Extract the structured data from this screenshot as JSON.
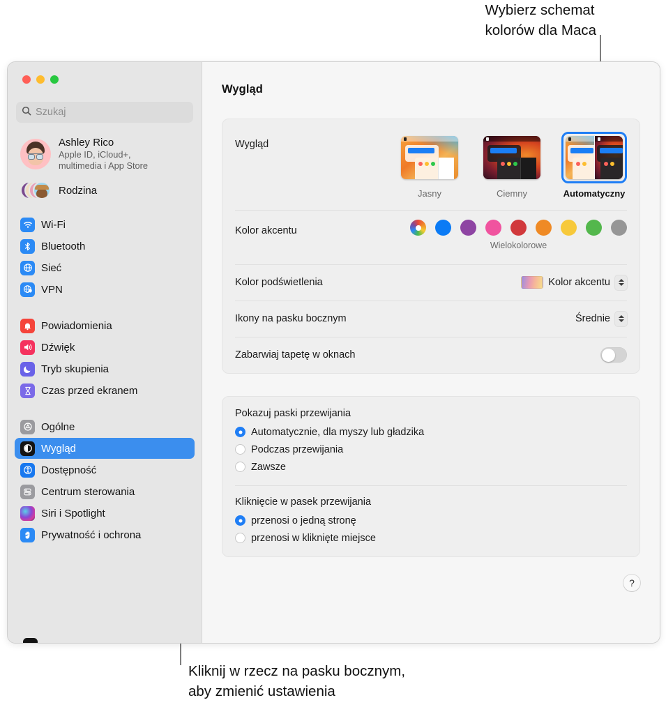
{
  "callouts": {
    "top": "Wybierz schemat\nkolorów dla Maca",
    "bottom": "Kliknij w rzecz na pasku bocznym,\naby zmienić ustawienia"
  },
  "window": {
    "traffic_lights": [
      "close-red",
      "minimize-yellow",
      "zoom-green"
    ]
  },
  "sidebar": {
    "search": {
      "placeholder": "Szukaj",
      "value": "",
      "icon": "search-icon"
    },
    "account": {
      "name": "Ashley Rico",
      "subtitle": "Apple ID, iCloud+,\nmultimedia i App Store",
      "subtitle_line1": "Apple ID, iCloud+,",
      "subtitle_line2": "multimedia i App Store"
    },
    "family": {
      "label": "Rodzina"
    },
    "groups": [
      {
        "items": [
          {
            "label": "Wi-Fi",
            "icon": "wifi-icon"
          },
          {
            "label": "Bluetooth",
            "icon": "bluetooth-icon"
          },
          {
            "label": "Sieć",
            "icon": "network-globe-icon"
          },
          {
            "label": "VPN",
            "icon": "vpn-shield-globe-icon"
          }
        ]
      },
      {
        "items": [
          {
            "label": "Powiadomienia",
            "icon": "notifications-bell-icon"
          },
          {
            "label": "Dźwięk",
            "icon": "sound-speaker-icon"
          },
          {
            "label": "Tryb skupienia",
            "icon": "focus-moon-icon"
          },
          {
            "label": "Czas przed ekranem",
            "icon": "screen-time-hourglass-icon"
          }
        ]
      },
      {
        "items": [
          {
            "label": "Ogólne",
            "icon": "general-gear-icon"
          },
          {
            "label": "Wygląd",
            "icon": "appearance-contrast-icon",
            "selected": true
          },
          {
            "label": "Dostępność",
            "icon": "accessibility-person-icon"
          },
          {
            "label": "Centrum sterowania",
            "icon": "control-center-sliders-icon"
          },
          {
            "label": "Siri i Spotlight",
            "icon": "siri-orb-icon"
          },
          {
            "label": "Prywatność i ochrona",
            "icon": "privacy-hand-icon"
          }
        ]
      }
    ]
  },
  "content": {
    "title": "Wygląd",
    "appearance": {
      "label": "Wygląd",
      "options": [
        {
          "label": "Jasny",
          "value": "light",
          "selected": false
        },
        {
          "label": "Ciemny",
          "value": "dark",
          "selected": false
        },
        {
          "label": "Automatyczny",
          "value": "auto",
          "selected": true
        }
      ]
    },
    "accent": {
      "label": "Kolor akcentu",
      "caption": "Wielokolorowe",
      "selected_index": 0,
      "swatches": [
        {
          "name": "multicolor",
          "color": "multicolor"
        },
        {
          "name": "blue",
          "color": "#0b7bf5"
        },
        {
          "name": "purple",
          "color": "#8e44a3"
        },
        {
          "name": "pink",
          "color": "#f0539f"
        },
        {
          "name": "red",
          "color": "#d1393c"
        },
        {
          "name": "orange",
          "color": "#ef8a25"
        },
        {
          "name": "yellow",
          "color": "#f7c93b"
        },
        {
          "name": "green",
          "color": "#53b74c"
        },
        {
          "name": "graphite",
          "color": "#969696"
        }
      ]
    },
    "highlight": {
      "label": "Kolor podświetlenia",
      "value": "Kolor akcentu"
    },
    "sidebar_icons": {
      "label": "Ikony na pasku bocznym",
      "value": "Średnie"
    },
    "wallpaper_tint": {
      "label": "Zabarwiaj tapetę w oknach",
      "enabled": false
    },
    "show_scrollbars": {
      "title": "Pokazuj paski przewijania",
      "options": [
        {
          "label": "Automatycznie, dla myszy lub gładzika",
          "selected": true
        },
        {
          "label": "Podczas przewijania",
          "selected": false
        },
        {
          "label": "Zawsze",
          "selected": false
        }
      ]
    },
    "click_scrollbar": {
      "title": "Kliknięcie w pasek przewijania",
      "options": [
        {
          "label": "przenosi o jedną stronę",
          "selected": true
        },
        {
          "label": "przenosi w kliknięte miejsce",
          "selected": false
        }
      ]
    },
    "help": {
      "label": "?"
    }
  },
  "colors": {
    "accent": "#3b8eee",
    "selection": "#1f7ef5",
    "sidebar_bg": "#e6e6e6",
    "content_bg": "#f6f6f6",
    "card_bg": "#efefef"
  }
}
